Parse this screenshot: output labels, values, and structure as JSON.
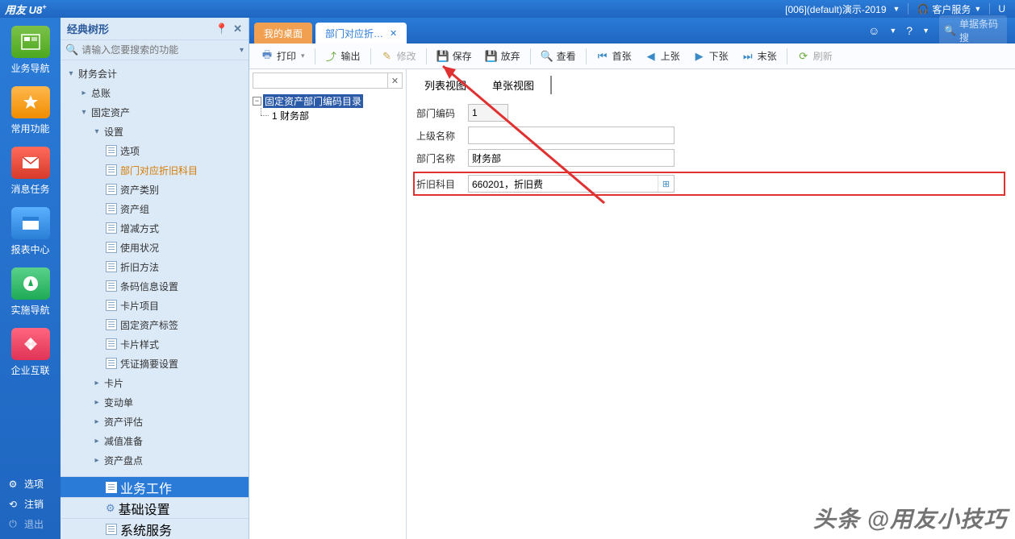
{
  "titlebar": {
    "logo_main": "用友",
    "logo_brand": "U8",
    "logo_sup": "+",
    "account": "[006](default)演示-2019",
    "service": "客户服务",
    "tail": "U"
  },
  "rail": {
    "nav": "业务导航",
    "fav": "常用功能",
    "msg": "消息任务",
    "rpt": "报表中心",
    "impl": "实施导航",
    "ent": "企业互联",
    "opt": "选项",
    "logout": "注销",
    "exit": "退出"
  },
  "tree": {
    "title": "经典树形",
    "search_ph": "请输入您要搜索的功能",
    "n0": "财务会计",
    "n1": "总账",
    "n2": "固定资产",
    "n3": "设置",
    "leaves": [
      "选项",
      "部门对应折旧科目",
      "资产类别",
      "资产组",
      "增减方式",
      "使用状况",
      "折旧方法",
      "条码信息设置",
      "卡片项目",
      "固定资产标签",
      "卡片样式",
      "凭证摘要设置"
    ],
    "n_card": "卡片",
    "n_change": "变动单",
    "n_eval": "资产评估",
    "n_imp": "减值准备",
    "n_inv": "资产盘点",
    "f_biz": "业务工作",
    "f_base": "基础设置",
    "f_sys": "系统服务"
  },
  "tabs": {
    "desktop": "我的桌面",
    "active": "部门对应折…",
    "search_ph": "单据条码搜"
  },
  "toolbar": {
    "print": "打印",
    "export": "输出",
    "edit": "修改",
    "save": "保存",
    "discard": "放弃",
    "view": "查看",
    "first": "首张",
    "prev": "上张",
    "next": "下张",
    "last": "末张",
    "refresh": "刷新"
  },
  "wa": {
    "root": "固定资产部门编码目录",
    "child": "1 财务部",
    "vt_list": "列表视图",
    "vt_single": "单张视图",
    "f_code": "部门编码",
    "f_code_v": "1",
    "f_parent": "上级名称",
    "f_parent_v": "",
    "f_name": "部门名称",
    "f_name_v": "财务部",
    "f_dep": "折旧科目",
    "f_dep_v": "660201，折旧费"
  },
  "watermark": "头条 @用友小技巧"
}
